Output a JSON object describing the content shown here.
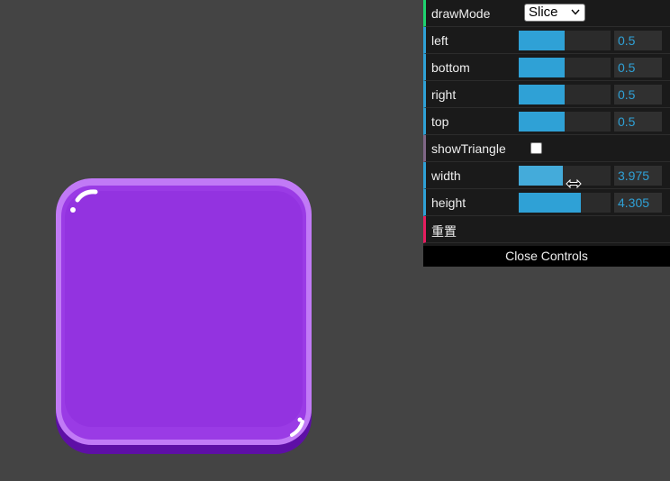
{
  "gui": {
    "drawMode": {
      "label": "drawMode",
      "selected": "Slice"
    },
    "sliders": [
      {
        "name": "left",
        "label": "left",
        "value": "0.5",
        "fraction": 0.5
      },
      {
        "name": "bottom",
        "label": "bottom",
        "value": "0.5",
        "fraction": 0.5
      },
      {
        "name": "right",
        "label": "right",
        "value": "0.5",
        "fraction": 0.5
      },
      {
        "name": "top",
        "label": "top",
        "value": "0.5",
        "fraction": 0.5
      }
    ],
    "showTriangle": {
      "label": "showTriangle",
      "checked": false
    },
    "sliders2": [
      {
        "name": "width",
        "label": "width",
        "value": "3.975",
        "fraction": 0.48
      },
      {
        "name": "height",
        "label": "height",
        "value": "4.305",
        "fraction": 0.68
      }
    ],
    "reset_label": "重置",
    "close_label": "Close Controls"
  },
  "colors": {
    "background": "#444444",
    "panel": "#1a1a1a",
    "slider_accent": "#2fa1d6",
    "sprite_purple": "#9333e0",
    "sprite_bottom": "#5e0fa6"
  },
  "icons": {
    "select_caret": "chevron-down-icon",
    "cursor": "resize-horizontal-icon"
  }
}
